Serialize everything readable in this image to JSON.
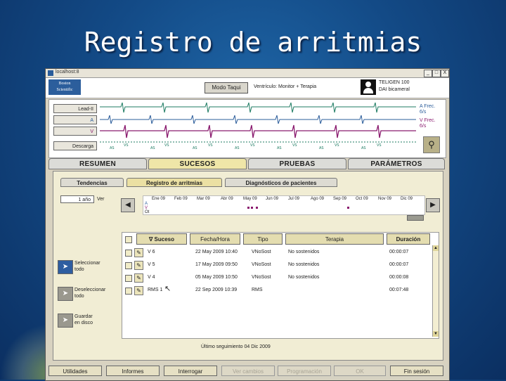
{
  "slide": {
    "title": "Registro de arritmias"
  },
  "window": {
    "title": "localhost:8",
    "controls": [
      "_",
      "□",
      "X"
    ],
    "app_icon": "boston-scientific-app-icon"
  },
  "header": {
    "logo_line1": "Boston",
    "logo_line2": "Scientific",
    "mode_button": "Modo Taqui",
    "mode_status": "Ventrículo: Monitor + Terapia",
    "device_name": "TELIGEN 100",
    "device_type": "DAI bicameral"
  },
  "ecg": {
    "buttons": [
      "Lead-II",
      "A",
      "V",
      "Descarga"
    ],
    "legend_a": [
      "A Frec.",
      "6/s"
    ],
    "legend_v": [
      "V Frec.",
      "6/s"
    ],
    "marker_a": "AS",
    "marker_v": "VS",
    "colors": {
      "lead": "#1d7b62",
      "atrial": "#2a5c9a",
      "ventricular": "#8a1a6e"
    }
  },
  "main_tabs": [
    "RESUMEN",
    "SUCESOS",
    "PRUEBAS",
    "PARÁMETROS"
  ],
  "sub_tabs": [
    "Tendencias",
    "Registro de arritmias",
    "Diagnósticos de pacientes"
  ],
  "timeline": {
    "period": "1 año",
    "period_label": "Ver",
    "months": [
      "Ene 09",
      "Feb 09",
      "Mar 09",
      "Abr 09",
      "May 09",
      "Jun 09",
      "Jul 09",
      "Ago 09",
      "Sep 09",
      "Oct 09",
      "Nov 09",
      "Dic 09"
    ],
    "series_labels": [
      "A",
      "V",
      "Ot"
    ]
  },
  "table": {
    "headers": [
      "∇ Suceso",
      "Fecha/Hora",
      "Tipo",
      "Terapia",
      "Duración"
    ],
    "rows": [
      {
        "event": "V  6",
        "datetime": "22 May 2009 10:40",
        "type": "VNoSost",
        "therapy": "No sostenidos",
        "duration": "00:00:07"
      },
      {
        "event": "V  5",
        "datetime": "17 May 2009 09:50",
        "type": "VNoSost",
        "therapy": "No sostenidos",
        "duration": "00:00:07"
      },
      {
        "event": "V  4",
        "datetime": "05 May 2009 10:50",
        "type": "VNoSost",
        "therapy": "No sostenidos",
        "duration": "00:00:08"
      },
      {
        "event": "RMS  1",
        "datetime": "22 Sep 2009 10:39",
        "type": "RMS",
        "therapy": "",
        "duration": "00:07:48"
      }
    ]
  },
  "actions": [
    {
      "line1": "Seleccionar",
      "line2": "todo"
    },
    {
      "line1": "Deseleccionar",
      "line2": "todo"
    },
    {
      "line1": "Guardar",
      "line2": "en disco"
    }
  ],
  "last_followup": "Último seguimiento 04 Dic 2009",
  "bottom_buttons": [
    "Utilidades",
    "Informes",
    "Interrogar",
    "Ver cambios",
    "Programación",
    "OK",
    "Fin sesión"
  ]
}
